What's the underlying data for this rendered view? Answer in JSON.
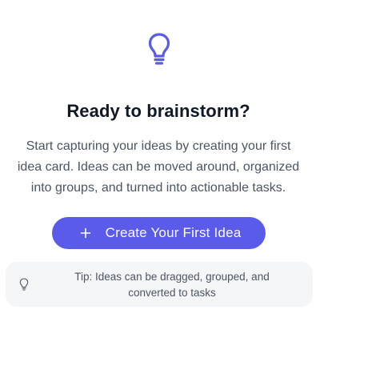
{
  "hero": {
    "icon": "lightbulb-icon",
    "title": "Ready to brainstorm?",
    "description_lines": [
      "Start capturing your ideas by creating your first",
      "idea card. Ideas can be moved around, organized",
      "into groups, and turned into actionable tasks."
    ]
  },
  "cta": {
    "icon": "plus-icon",
    "label": "Create Your First Idea"
  },
  "tip": {
    "icon": "lightbulb-icon",
    "text_lines": [
      "Tip: Ideas can be dragged, grouped, and",
      "converted to tasks"
    ]
  },
  "colors": {
    "accent": "#5b5bea",
    "title": "#111827",
    "body_text": "#4b5563",
    "tip_background": "#f5f6f8",
    "background": "#ffffff"
  }
}
